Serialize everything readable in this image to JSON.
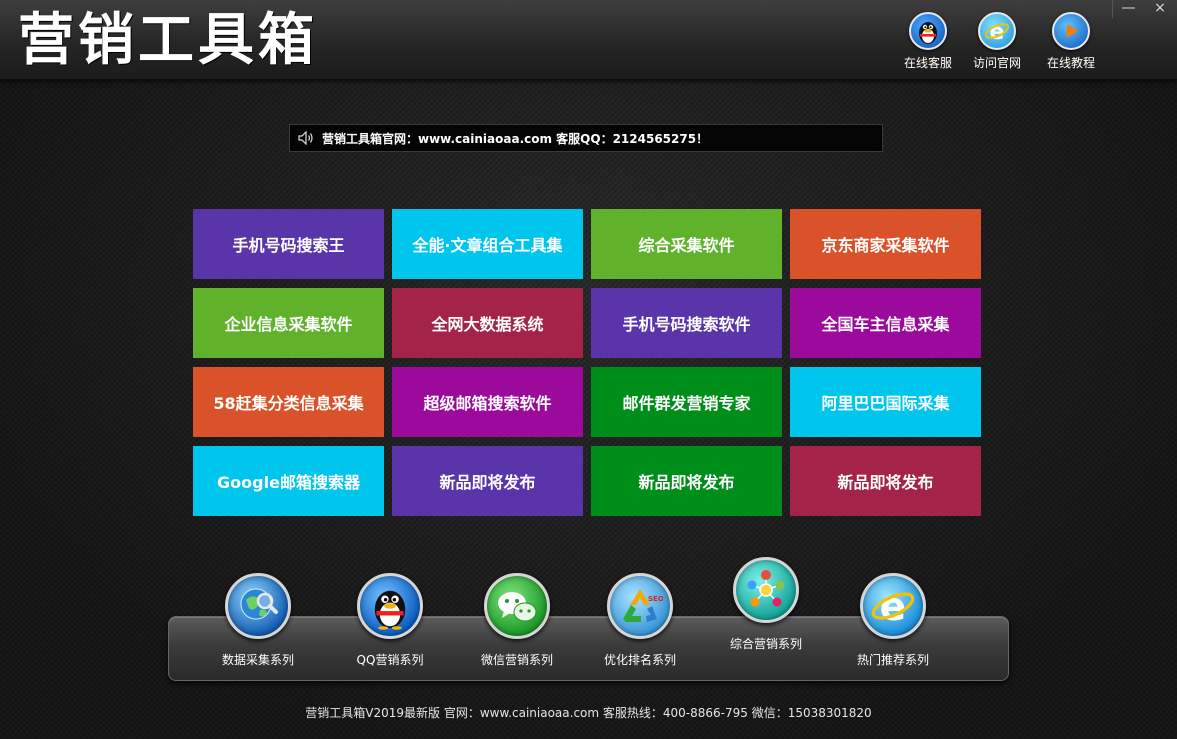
{
  "app": {
    "title": "营销工具箱"
  },
  "window": {
    "minimize": "—",
    "close": "×"
  },
  "header_buttons": [
    {
      "label": "在线客服",
      "icon": "qq-penguin-icon"
    },
    {
      "label": "访问官网",
      "icon": "ie-browser-icon"
    },
    {
      "label": "在线教程",
      "icon": "play-icon"
    }
  ],
  "notice": {
    "text": "营销工具箱官网：www.cainiaoaa.com 客服QQ：2124565275！",
    "icon": "speaker-icon"
  },
  "tiles": [
    {
      "label": "手机号码搜索王",
      "color": "#5a35a9"
    },
    {
      "label": "全能·文章组合工具集",
      "color": "#00c6ee"
    },
    {
      "label": "综合采集软件",
      "color": "#60b12b"
    },
    {
      "label": "京东商家采集软件",
      "color": "#d9522a"
    },
    {
      "label": "企业信息采集软件",
      "color": "#60b12b"
    },
    {
      "label": "全网大数据系统",
      "color": "#a32448"
    },
    {
      "label": "手机号码搜索软件",
      "color": "#5a35a9"
    },
    {
      "label": "全国车主信息采集",
      "color": "#9b0a9b"
    },
    {
      "label": "58赶集分类信息采集",
      "color": "#d9522a"
    },
    {
      "label": "超级邮箱搜索软件",
      "color": "#9b0a9b"
    },
    {
      "label": "邮件群发营销专家",
      "color": "#008e1a"
    },
    {
      "label": "阿里巴巴国际采集",
      "color": "#00c6ee"
    },
    {
      "label": "Google邮箱搜索器",
      "color": "#00c6ee"
    },
    {
      "label": "新品即将发布",
      "color": "#5a35a9"
    },
    {
      "label": "新品即将发布",
      "color": "#008e1a"
    },
    {
      "label": "新品即将发布",
      "color": "#a32448"
    }
  ],
  "dock": [
    {
      "label": "数据采集系列",
      "icon": "globe-search-icon"
    },
    {
      "label": "QQ营销系列",
      "icon": "qq-penguin-icon"
    },
    {
      "label": "微信营销系列",
      "icon": "wechat-icon"
    },
    {
      "label": "优化排名系列",
      "icon": "seo-recycle-icon"
    },
    {
      "label": "综合营销系列",
      "icon": "social-network-icon"
    },
    {
      "label": "热门推荐系列",
      "icon": "ie-browser-icon"
    }
  ],
  "footer": {
    "text": "营销工具箱V2019最新版 官网：www.cainiaoaa.com 客服热线：400-8866-795 微信：15038301820"
  }
}
